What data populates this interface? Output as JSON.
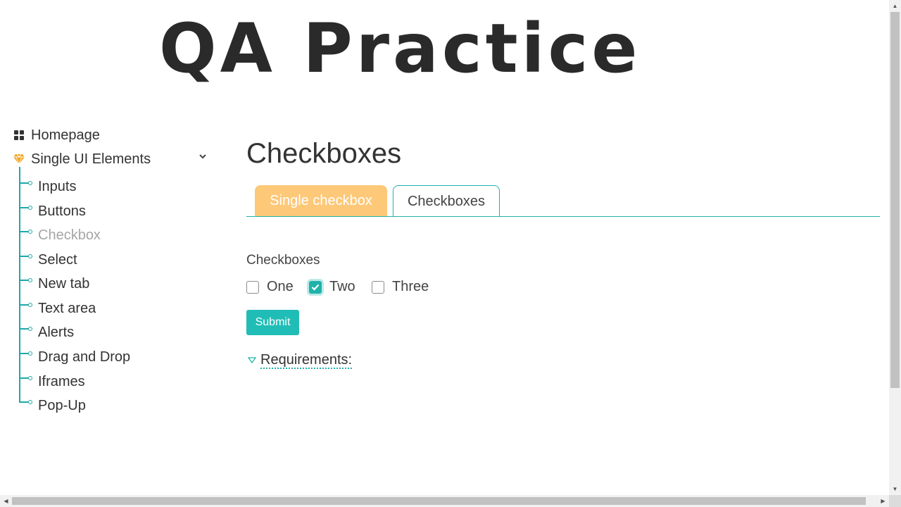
{
  "header": {
    "logo_text": "QA Practice"
  },
  "sidebar": {
    "homepage": "Homepage",
    "single_ui": "Single UI Elements",
    "items": [
      {
        "label": "Inputs",
        "active": false
      },
      {
        "label": "Buttons",
        "active": false
      },
      {
        "label": "Checkbox",
        "active": true
      },
      {
        "label": "Select",
        "active": false
      },
      {
        "label": "New tab",
        "active": false
      },
      {
        "label": "Text area",
        "active": false
      },
      {
        "label": "Alerts",
        "active": false
      },
      {
        "label": "Drag and Drop",
        "active": false
      },
      {
        "label": "Iframes",
        "active": false
      },
      {
        "label": "Pop-Up",
        "active": false
      }
    ]
  },
  "main": {
    "title": "Checkboxes",
    "tabs": [
      {
        "label": "Single checkbox"
      },
      {
        "label": "Checkboxes"
      }
    ],
    "group_label": "Checkboxes",
    "checkboxes": [
      {
        "label": "One",
        "checked": false
      },
      {
        "label": "Two",
        "checked": true
      },
      {
        "label": "Three",
        "checked": false
      }
    ],
    "submit_label": "Submit",
    "requirements_label": "Requirements:"
  },
  "colors": {
    "accent": "#20b2aa",
    "tab_orange": "#fdc878",
    "active_nav": "#a6a6a6",
    "homepage_icon": "#333333",
    "gem_icon": "#f5a623"
  },
  "icons": {
    "homepage": "grid-icon",
    "single_ui": "gem-icon",
    "expand": "chevron-down-icon",
    "requirements": "triangle-down-icon",
    "checkmark": "check-icon"
  }
}
